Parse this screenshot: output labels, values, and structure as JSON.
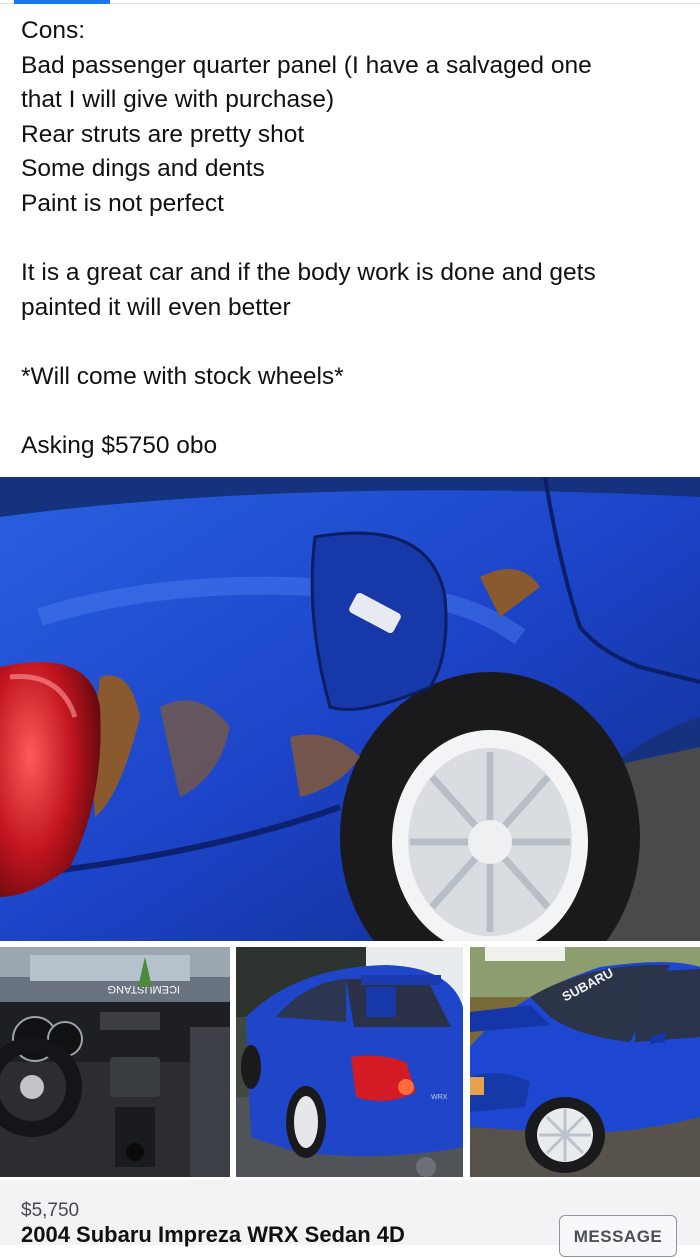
{
  "post": {
    "lines": [
      "Cons:",
      "Bad passenger quarter panel (I have a salvaged one",
      "that I will give with purchase)",
      "Rear struts are pretty shot",
      "Some dings and dents",
      "Paint is not perfect",
      "It is a great car and if the body work is done and gets",
      "painted it will even better",
      "*Will come with stock wheels*",
      "Asking $5750 obo"
    ]
  },
  "photos": {
    "main": "rear quarter panel damage",
    "thumbs": [
      "interior dashboard",
      "rear three-quarter view",
      "front three-quarter view"
    ],
    "thumb_text": {
      "banner": "ICEMUSTANG",
      "windshield": "SUBARU",
      "badge": "WRX"
    }
  },
  "listing": {
    "price": "$5,750",
    "title": "2004 Subaru Impreza WRX Sedan 4D",
    "message_label": "MESSAGE"
  },
  "colors": {
    "accent": "#1877f2",
    "car_blue": "#1a3fc4",
    "listing_bar": "#f2f3f5"
  }
}
